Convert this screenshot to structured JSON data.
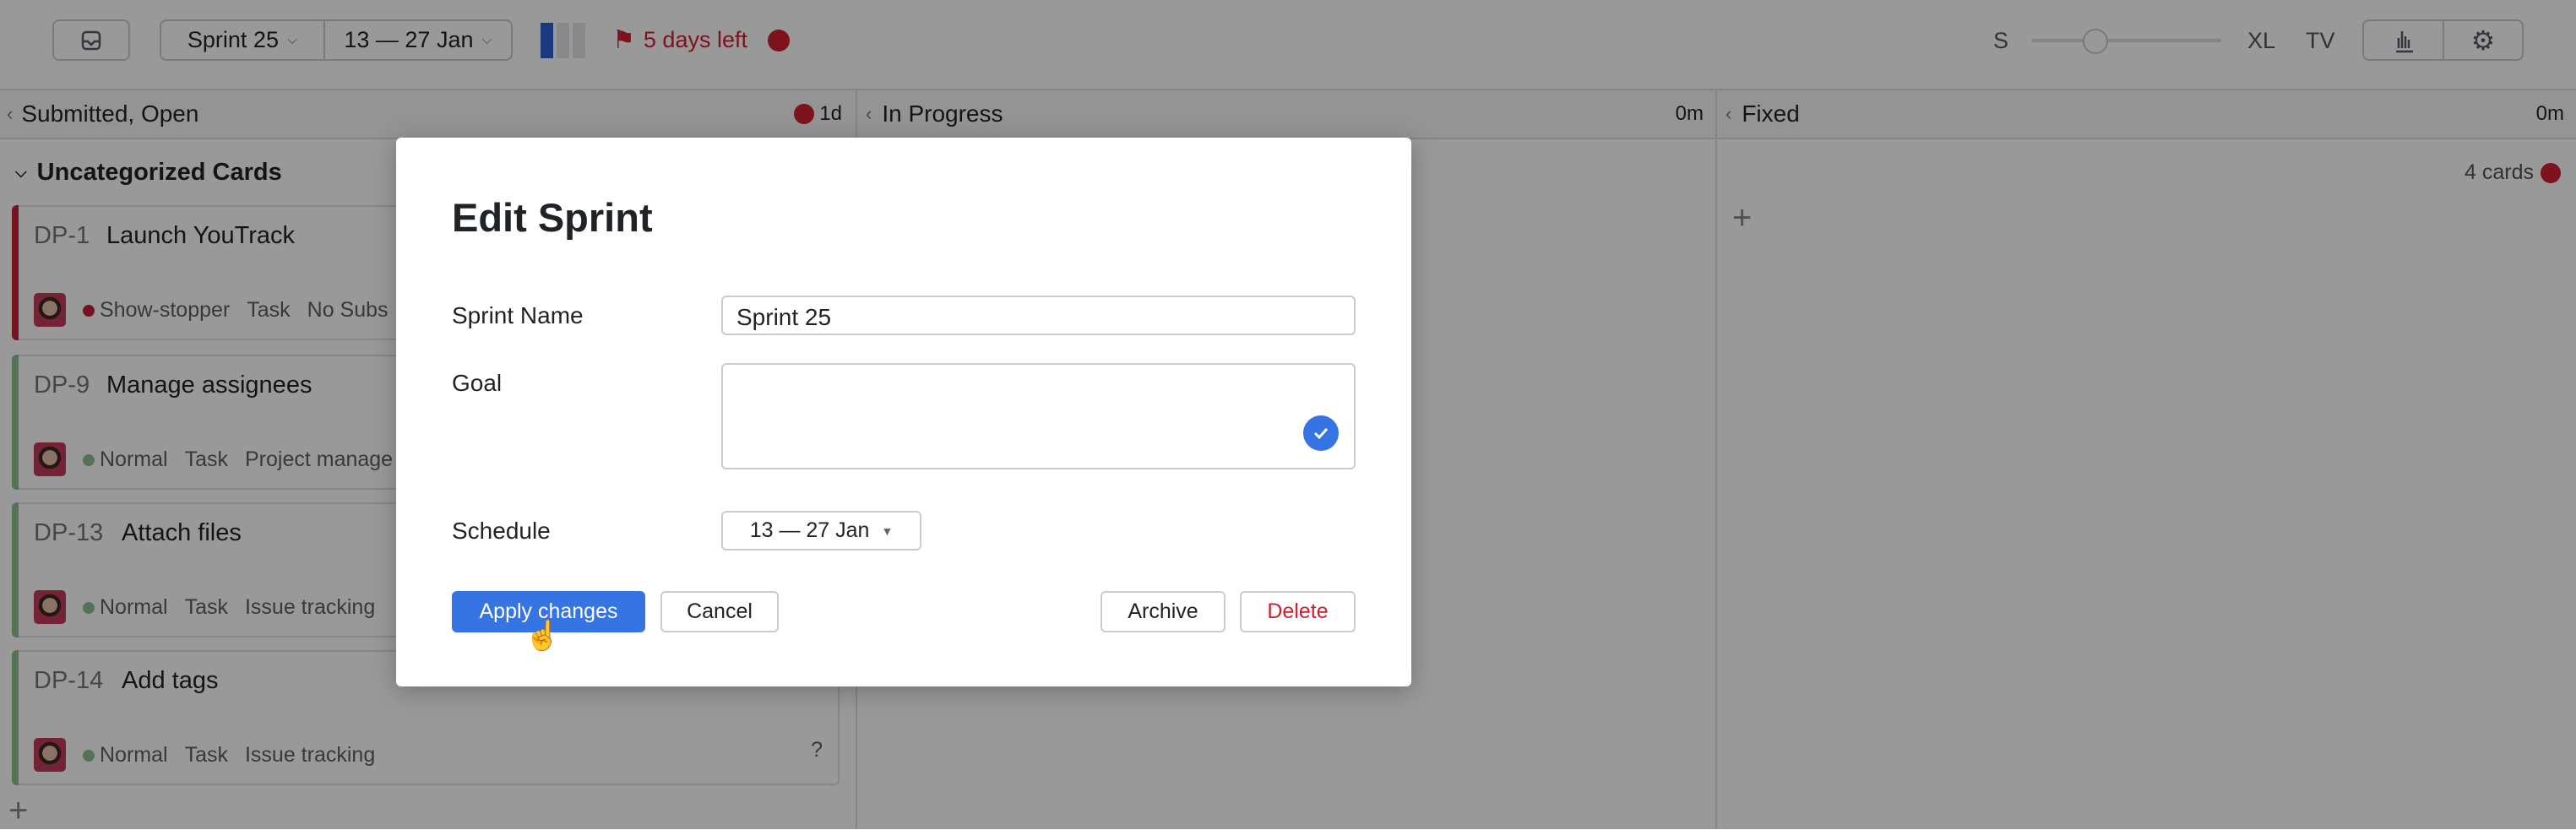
{
  "topbar": {
    "sprint": "Sprint 25",
    "dates": "13 — 27 Jan",
    "days_left": "5 days left",
    "size_small": "S",
    "size_xl": "XL",
    "size_tv": "TV"
  },
  "columns": [
    {
      "title": "Submitted, Open",
      "time": "1d"
    },
    {
      "title": "In Progress",
      "time": "0m"
    },
    {
      "title": "Fixed",
      "time": "0m"
    }
  ],
  "swimlane": {
    "title": "Uncategorized Cards",
    "count": "4 cards"
  },
  "cards": [
    {
      "id": "DP-1",
      "title": "Launch YouTrack",
      "priority": "Show-stopper",
      "type": "Task",
      "subsystem": "No Subs",
      "priority_color": "#c4203a"
    },
    {
      "id": "DP-9",
      "title": "Manage assignees",
      "priority": "Normal",
      "type": "Task",
      "subsystem": "Project manage",
      "priority_color": "#8cc08c"
    },
    {
      "id": "DP-13",
      "title": "Attach files",
      "priority": "Normal",
      "type": "Task",
      "subsystem": "Issue tracking",
      "priority_color": "#8cc08c"
    },
    {
      "id": "DP-14",
      "title": "Add tags",
      "priority": "Normal",
      "type": "Task",
      "subsystem": "Issue tracking",
      "estimate": "?",
      "priority_color": "#8cc08c"
    }
  ],
  "dialog": {
    "title": "Edit Sprint",
    "name_label": "Sprint Name",
    "name_value": "Sprint 25",
    "goal_label": "Goal",
    "goal_value": "",
    "schedule_label": "Schedule",
    "schedule_value": "13 — 27 Jan",
    "apply": "Apply changes",
    "cancel": "Cancel",
    "archive": "Archive",
    "delete": "Delete"
  },
  "colors": {
    "accent": "#3574e2",
    "danger": "#d0202f"
  }
}
